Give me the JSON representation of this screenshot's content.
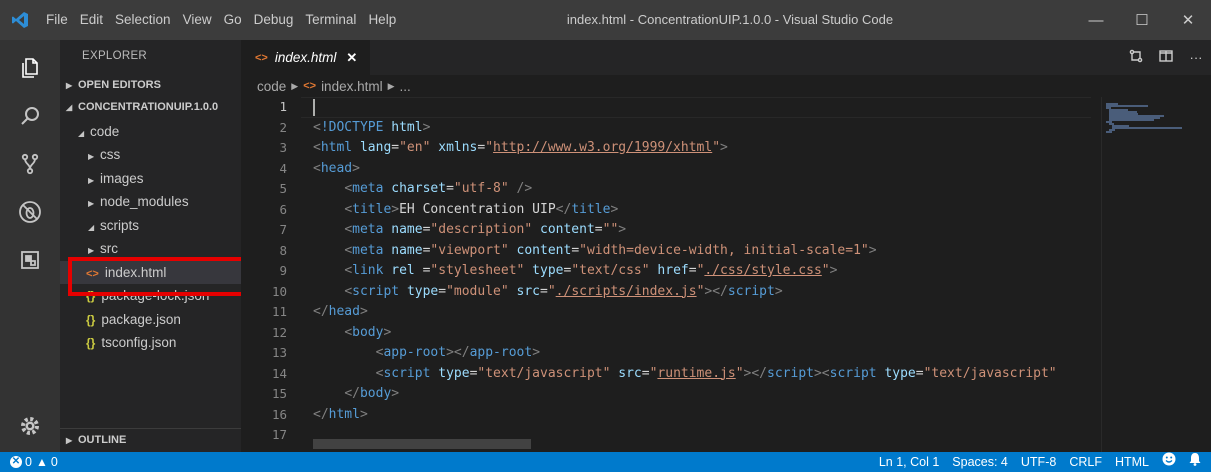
{
  "window": {
    "title": "index.html - ConcentrationUIP.1.0.0 - Visual Studio Code",
    "controls": {
      "minimize": "—",
      "maximize": "☐",
      "close": "✕"
    }
  },
  "menu": [
    "File",
    "Edit",
    "Selection",
    "View",
    "Go",
    "Debug",
    "Terminal",
    "Help"
  ],
  "sidebar": {
    "title": "EXPLORER",
    "open_editors": "OPEN EDITORS",
    "project": "CONCENTRATIONUIP.1.0.0",
    "outline": "OUTLINE",
    "tree": [
      {
        "label": "code",
        "kind": "folder-open"
      },
      {
        "label": "css",
        "kind": "folder"
      },
      {
        "label": "images",
        "kind": "folder"
      },
      {
        "label": "node_modules",
        "kind": "folder"
      },
      {
        "label": "scripts",
        "kind": "folder-open"
      },
      {
        "label": "src",
        "kind": "folder"
      },
      {
        "label": "index.html",
        "kind": "html",
        "selected": true
      },
      {
        "label": "package-lock.json",
        "kind": "json"
      },
      {
        "label": "package.json",
        "kind": "json"
      },
      {
        "label": "tsconfig.json",
        "kind": "json"
      }
    ]
  },
  "tab": {
    "label": "index.html",
    "close": "✕"
  },
  "breadcrumb": {
    "folder": "code",
    "file": "index.html",
    "more": "..."
  },
  "editor": {
    "line_numbers": [
      "1",
      "2",
      "3",
      "4",
      "5",
      "6",
      "7",
      "8",
      "9",
      "10",
      "11",
      "12",
      "13",
      "14",
      "15",
      "16",
      "17"
    ],
    "lines": [
      [],
      [
        [
          "punc",
          "<"
        ],
        [
          "tag",
          "!DOCTYPE"
        ],
        [
          "text",
          " "
        ],
        [
          "attr",
          "html"
        ],
        [
          "punc",
          ">"
        ]
      ],
      [
        [
          "punc",
          "<"
        ],
        [
          "tag",
          "html"
        ],
        [
          "text",
          " "
        ],
        [
          "attr",
          "lang"
        ],
        [
          "text",
          "="
        ],
        [
          "str",
          "\"en\""
        ],
        [
          "text",
          " "
        ],
        [
          "attr",
          "xmlns"
        ],
        [
          "text",
          "="
        ],
        [
          "str",
          "\""
        ],
        [
          "link",
          "http://www.w3.org/1999/xhtml"
        ],
        [
          "str",
          "\""
        ],
        [
          "punc",
          ">"
        ]
      ],
      [
        [
          "punc",
          "<"
        ],
        [
          "tag",
          "head"
        ],
        [
          "punc",
          ">"
        ]
      ],
      [
        [
          "text",
          "    "
        ],
        [
          "punc",
          "<"
        ],
        [
          "tag",
          "meta"
        ],
        [
          "text",
          " "
        ],
        [
          "attr",
          "charset"
        ],
        [
          "text",
          "="
        ],
        [
          "str",
          "\"utf-8\""
        ],
        [
          "text",
          " "
        ],
        [
          "punc",
          "/>"
        ]
      ],
      [
        [
          "text",
          "    "
        ],
        [
          "punc",
          "<"
        ],
        [
          "tag",
          "title"
        ],
        [
          "punc",
          ">"
        ],
        [
          "text",
          "EH Concentration UIP"
        ],
        [
          "punc",
          "</"
        ],
        [
          "tag",
          "title"
        ],
        [
          "punc",
          ">"
        ]
      ],
      [
        [
          "text",
          "    "
        ],
        [
          "punc",
          "<"
        ],
        [
          "tag",
          "meta"
        ],
        [
          "text",
          " "
        ],
        [
          "attr",
          "name"
        ],
        [
          "text",
          "="
        ],
        [
          "str",
          "\"description\""
        ],
        [
          "text",
          " "
        ],
        [
          "attr",
          "content"
        ],
        [
          "text",
          "="
        ],
        [
          "str",
          "\"\""
        ],
        [
          "punc",
          ">"
        ]
      ],
      [
        [
          "text",
          "    "
        ],
        [
          "punc",
          "<"
        ],
        [
          "tag",
          "meta"
        ],
        [
          "text",
          " "
        ],
        [
          "attr",
          "name"
        ],
        [
          "text",
          "="
        ],
        [
          "str",
          "\"viewport\""
        ],
        [
          "text",
          " "
        ],
        [
          "attr",
          "content"
        ],
        [
          "text",
          "="
        ],
        [
          "str",
          "\"width=device-width, initial-scale=1\""
        ],
        [
          "punc",
          ">"
        ]
      ],
      [
        [
          "text",
          "    "
        ],
        [
          "punc",
          "<"
        ],
        [
          "tag",
          "link"
        ],
        [
          "text",
          " "
        ],
        [
          "attr",
          "rel"
        ],
        [
          "text",
          " ="
        ],
        [
          "str",
          "\"stylesheet\""
        ],
        [
          "text",
          " "
        ],
        [
          "attr",
          "type"
        ],
        [
          "text",
          "="
        ],
        [
          "str",
          "\"text/css\""
        ],
        [
          "text",
          " "
        ],
        [
          "attr",
          "href"
        ],
        [
          "text",
          "="
        ],
        [
          "str",
          "\""
        ],
        [
          "link",
          "./css/style.css"
        ],
        [
          "str",
          "\""
        ],
        [
          "punc",
          ">"
        ]
      ],
      [
        [
          "text",
          "    "
        ],
        [
          "punc",
          "<"
        ],
        [
          "tag",
          "script"
        ],
        [
          "text",
          " "
        ],
        [
          "attr",
          "type"
        ],
        [
          "text",
          "="
        ],
        [
          "str",
          "\"module\""
        ],
        [
          "text",
          " "
        ],
        [
          "attr",
          "src"
        ],
        [
          "text",
          "="
        ],
        [
          "str",
          "\""
        ],
        [
          "link",
          "./scripts/index.js"
        ],
        [
          "str",
          "\""
        ],
        [
          "punc",
          "></"
        ],
        [
          "tag",
          "script"
        ],
        [
          "punc",
          ">"
        ]
      ],
      [
        [
          "punc",
          "</"
        ],
        [
          "tag",
          "head"
        ],
        [
          "punc",
          ">"
        ]
      ],
      [
        [
          "text",
          "    "
        ],
        [
          "punc",
          "<"
        ],
        [
          "tag",
          "body"
        ],
        [
          "punc",
          ">"
        ]
      ],
      [
        [
          "text",
          "        "
        ],
        [
          "punc",
          "<"
        ],
        [
          "tag",
          "app-root"
        ],
        [
          "punc",
          "></"
        ],
        [
          "tag",
          "app-root"
        ],
        [
          "punc",
          ">"
        ]
      ],
      [
        [
          "text",
          "        "
        ],
        [
          "punc",
          "<"
        ],
        [
          "tag",
          "script"
        ],
        [
          "text",
          " "
        ],
        [
          "attr",
          "type"
        ],
        [
          "text",
          "="
        ],
        [
          "str",
          "\"text/javascript\""
        ],
        [
          "text",
          " "
        ],
        [
          "attr",
          "src"
        ],
        [
          "text",
          "="
        ],
        [
          "str",
          "\""
        ],
        [
          "link",
          "runtime.js"
        ],
        [
          "str",
          "\""
        ],
        [
          "punc",
          "></"
        ],
        [
          "tag",
          "script"
        ],
        [
          "punc",
          "><"
        ],
        [
          "tag",
          "script"
        ],
        [
          "text",
          " "
        ],
        [
          "attr",
          "type"
        ],
        [
          "text",
          "="
        ],
        [
          "str",
          "\"text/javascript\""
        ]
      ],
      [
        [
          "text",
          "    "
        ],
        [
          "punc",
          "</"
        ],
        [
          "tag",
          "body"
        ],
        [
          "punc",
          ">"
        ]
      ],
      [
        [
          "punc",
          "</"
        ],
        [
          "tag",
          "html"
        ],
        [
          "punc",
          ">"
        ]
      ],
      []
    ]
  },
  "status": {
    "errors": "0",
    "warnings": "0",
    "position": "Ln 1, Col 1",
    "spaces": "Spaces: 4",
    "encoding": "UTF-8",
    "eol": "CRLF",
    "language": "HTML"
  },
  "colors": {
    "statusbar": "#007acc",
    "highlight": "#e60000",
    "html_icon": "#e37933",
    "json_icon": "#cbcb41"
  }
}
